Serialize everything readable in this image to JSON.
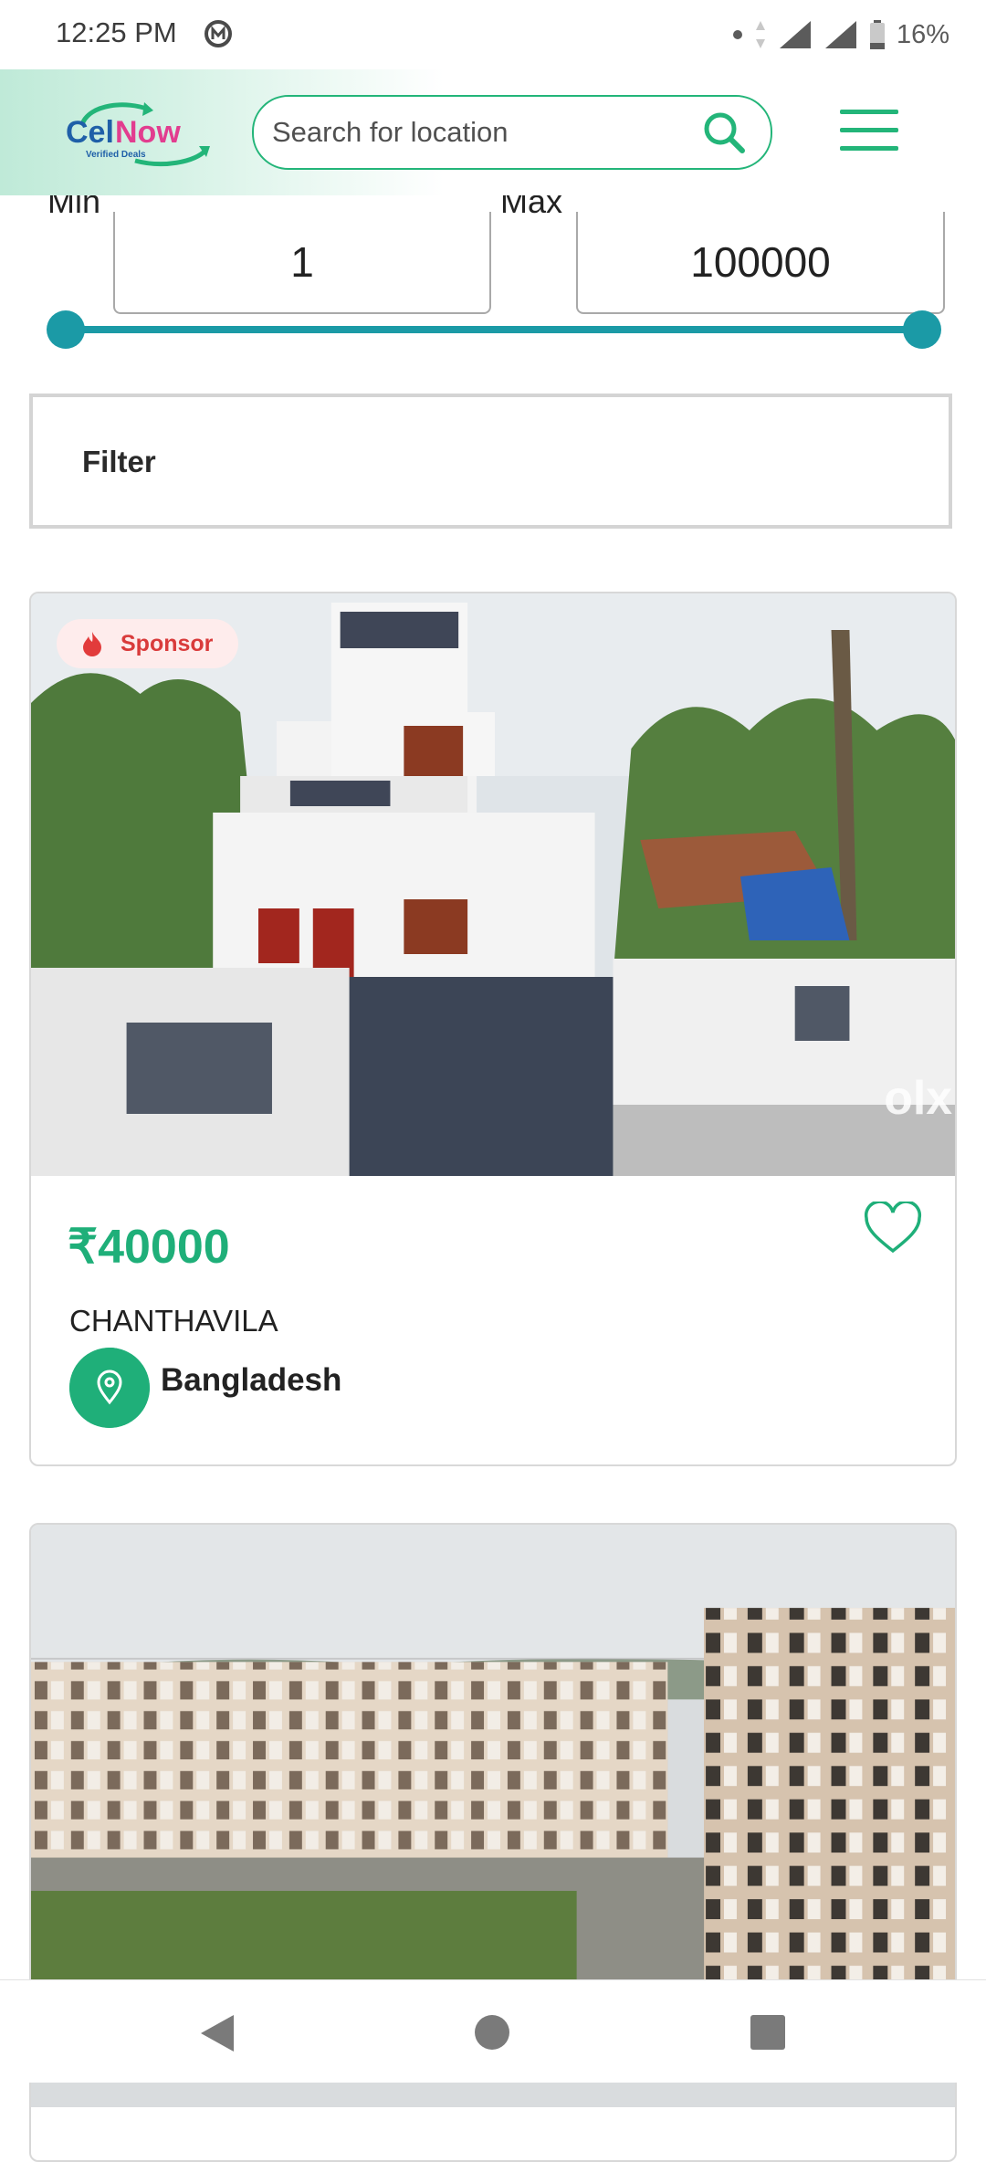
{
  "status_bar": {
    "time": "12:25 PM",
    "battery": "16%"
  },
  "header": {
    "logo_text": "CelNow",
    "logo_tagline": "Verified Deals",
    "search_placeholder": "Search for location"
  },
  "price_range": {
    "min_label": "Min",
    "min_value": "1",
    "max_label": "Max",
    "max_value": "100000",
    "slider_min_fraction": 0.0,
    "slider_max_fraction": 1.0
  },
  "filter": {
    "label": "Filter"
  },
  "listings": [
    {
      "badge": "Sponsor",
      "price": "₹40000",
      "name": "CHANTHAVILA",
      "location": "Bangladesh",
      "favorited": false
    },
    {}
  ],
  "colors": {
    "brand_green": "#1faf79",
    "slider_teal": "#1b9aa6",
    "sponsor_red": "#d93b3b"
  },
  "icons": [
    "search-icon",
    "menu-icon",
    "heart-icon",
    "location-pin-icon",
    "flame-icon",
    "back-icon",
    "home-icon",
    "recents-icon"
  ]
}
